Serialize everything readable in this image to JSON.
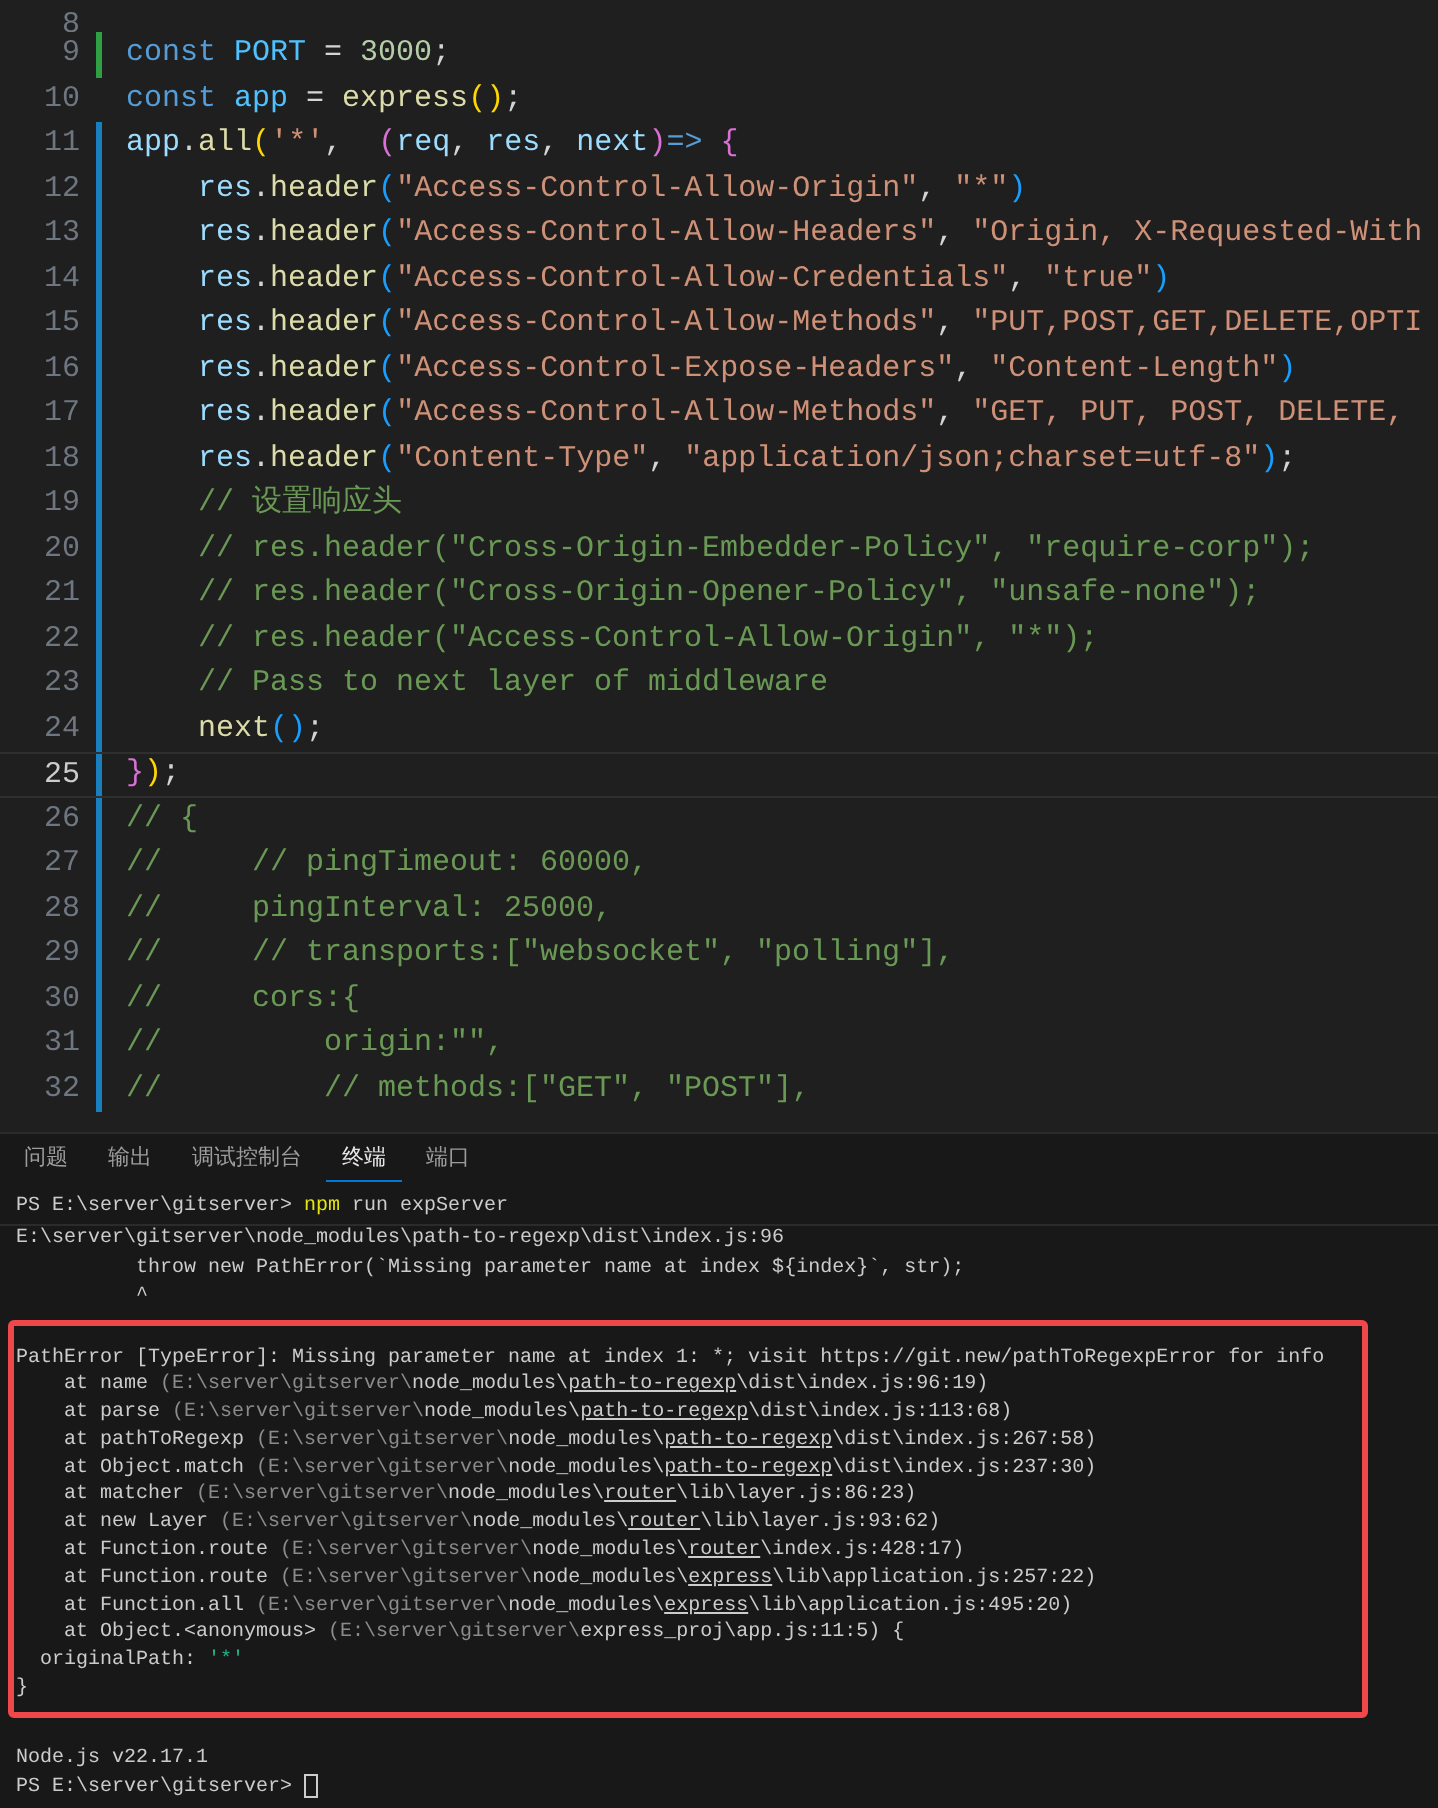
{
  "editor": {
    "lines": [
      {
        "number": "8",
        "added": false,
        "modified": false,
        "current": false
      },
      {
        "number": "9",
        "added": true,
        "modified": false,
        "current": false,
        "segments": [
          {
            "kind": "kw",
            "text": "const "
          },
          {
            "kind": "const",
            "text": "PORT"
          },
          {
            "kind": "txt",
            "text": " = "
          },
          {
            "kind": "num",
            "text": "3000"
          },
          {
            "kind": "txt",
            "text": ";"
          }
        ]
      },
      {
        "number": "10",
        "added": false,
        "modified": false,
        "current": false,
        "segments": [
          {
            "kind": "kw",
            "text": "const "
          },
          {
            "kind": "const",
            "text": "app"
          },
          {
            "kind": "txt",
            "text": " = "
          },
          {
            "kind": "fn",
            "text": "express"
          },
          {
            "kind": "b1",
            "text": "()"
          },
          {
            "kind": "txt",
            "text": ";"
          }
        ]
      },
      {
        "number": "11",
        "added": false,
        "modified": true,
        "current": false,
        "segments": [
          {
            "kind": "var",
            "text": "app"
          },
          {
            "kind": "txt",
            "text": "."
          },
          {
            "kind": "fn",
            "text": "all"
          },
          {
            "kind": "b1",
            "text": "("
          },
          {
            "kind": "str",
            "text": "'*'"
          },
          {
            "kind": "txt",
            "text": ",  "
          },
          {
            "kind": "b2",
            "text": "("
          },
          {
            "kind": "var",
            "text": "req"
          },
          {
            "kind": "txt",
            "text": ", "
          },
          {
            "kind": "var",
            "text": "res"
          },
          {
            "kind": "txt",
            "text": ", "
          },
          {
            "kind": "var",
            "text": "next"
          },
          {
            "kind": "b2",
            "text": ")"
          },
          {
            "kind": "kw",
            "text": "=>"
          },
          {
            "kind": "b2",
            "text": " {"
          }
        ]
      },
      {
        "number": "12",
        "added": false,
        "modified": true,
        "current": false,
        "segments": [
          {
            "kind": "var",
            "text": "    res"
          },
          {
            "kind": "txt",
            "text": "."
          },
          {
            "kind": "fn",
            "text": "header"
          },
          {
            "kind": "b3",
            "text": "("
          },
          {
            "kind": "str",
            "text": "\"Access-Control-Allow-Origin\""
          },
          {
            "kind": "txt",
            "text": ", "
          },
          {
            "kind": "str",
            "text": "\"*\""
          },
          {
            "kind": "b3",
            "text": ")"
          }
        ]
      },
      {
        "number": "13",
        "added": false,
        "modified": true,
        "current": false,
        "segments": [
          {
            "kind": "var",
            "text": "    res"
          },
          {
            "kind": "txt",
            "text": "."
          },
          {
            "kind": "fn",
            "text": "header"
          },
          {
            "kind": "b3",
            "text": "("
          },
          {
            "kind": "str",
            "text": "\"Access-Control-Allow-Headers\""
          },
          {
            "kind": "txt",
            "text": ", "
          },
          {
            "kind": "str",
            "text": "\"Origin, X-Requested-With"
          }
        ]
      },
      {
        "number": "14",
        "added": false,
        "modified": true,
        "current": false,
        "segments": [
          {
            "kind": "var",
            "text": "    res"
          },
          {
            "kind": "txt",
            "text": "."
          },
          {
            "kind": "fn",
            "text": "header"
          },
          {
            "kind": "b3",
            "text": "("
          },
          {
            "kind": "str",
            "text": "\"Access-Control-Allow-Credentials\""
          },
          {
            "kind": "txt",
            "text": ", "
          },
          {
            "kind": "str",
            "text": "\"true\""
          },
          {
            "kind": "b3",
            "text": ")"
          }
        ]
      },
      {
        "number": "15",
        "added": false,
        "modified": true,
        "current": false,
        "segments": [
          {
            "kind": "var",
            "text": "    res"
          },
          {
            "kind": "txt",
            "text": "."
          },
          {
            "kind": "fn",
            "text": "header"
          },
          {
            "kind": "b3",
            "text": "("
          },
          {
            "kind": "str",
            "text": "\"Access-Control-Allow-Methods\""
          },
          {
            "kind": "txt",
            "text": ", "
          },
          {
            "kind": "str",
            "text": "\"PUT,POST,GET,DELETE,OPTI"
          }
        ]
      },
      {
        "number": "16",
        "added": false,
        "modified": true,
        "current": false,
        "segments": [
          {
            "kind": "var",
            "text": "    res"
          },
          {
            "kind": "txt",
            "text": "."
          },
          {
            "kind": "fn",
            "text": "header"
          },
          {
            "kind": "b3",
            "text": "("
          },
          {
            "kind": "str",
            "text": "\"Access-Control-Expose-Headers\""
          },
          {
            "kind": "txt",
            "text": ", "
          },
          {
            "kind": "str",
            "text": "\"Content-Length\""
          },
          {
            "kind": "b3",
            "text": ")"
          }
        ]
      },
      {
        "number": "17",
        "added": false,
        "modified": true,
        "current": false,
        "segments": [
          {
            "kind": "var",
            "text": "    res"
          },
          {
            "kind": "txt",
            "text": "."
          },
          {
            "kind": "fn",
            "text": "header"
          },
          {
            "kind": "b3",
            "text": "("
          },
          {
            "kind": "str",
            "text": "\"Access-Control-Allow-Methods\""
          },
          {
            "kind": "txt",
            "text": ", "
          },
          {
            "kind": "str",
            "text": "\"GET, PUT, POST, DELETE,"
          }
        ]
      },
      {
        "number": "18",
        "added": false,
        "modified": true,
        "current": false,
        "segments": [
          {
            "kind": "var",
            "text": "    res"
          },
          {
            "kind": "txt",
            "text": "."
          },
          {
            "kind": "fn",
            "text": "header"
          },
          {
            "kind": "b3",
            "text": "("
          },
          {
            "kind": "str",
            "text": "\"Content-Type\""
          },
          {
            "kind": "txt",
            "text": ", "
          },
          {
            "kind": "str",
            "text": "\"application/json;charset=utf-8\""
          },
          {
            "kind": "b3",
            "text": ")"
          },
          {
            "kind": "txt",
            "text": ";"
          }
        ]
      },
      {
        "number": "19",
        "added": false,
        "modified": true,
        "current": false,
        "segments": [
          {
            "kind": "cmt",
            "text": "    // 设置响应头"
          }
        ]
      },
      {
        "number": "20",
        "added": false,
        "modified": true,
        "current": false,
        "segments": [
          {
            "kind": "cmt",
            "text": "    // res.header(\"Cross-Origin-Embedder-Policy\", \"require-corp\");"
          }
        ]
      },
      {
        "number": "21",
        "added": false,
        "modified": true,
        "current": false,
        "segments": [
          {
            "kind": "cmt",
            "text": "    // res.header(\"Cross-Origin-Opener-Policy\", \"unsafe-none\");"
          }
        ]
      },
      {
        "number": "22",
        "added": false,
        "modified": true,
        "current": false,
        "segments": [
          {
            "kind": "cmt",
            "text": "    // res.header(\"Access-Control-Allow-Origin\", \"*\");"
          }
        ]
      },
      {
        "number": "23",
        "added": false,
        "modified": true,
        "current": false,
        "segments": [
          {
            "kind": "cmt",
            "text": "    // Pass to next layer of middleware"
          }
        ]
      },
      {
        "number": "24",
        "added": false,
        "modified": true,
        "current": false,
        "segments": [
          {
            "kind": "fn",
            "text": "    next"
          },
          {
            "kind": "b3",
            "text": "()"
          },
          {
            "kind": "txt",
            "text": ";"
          }
        ]
      },
      {
        "number": "25",
        "added": false,
        "modified": true,
        "current": true,
        "segments": [
          {
            "kind": "b2",
            "text": "}"
          },
          {
            "kind": "b1",
            "text": ")"
          },
          {
            "kind": "txt",
            "text": ";"
          }
        ]
      },
      {
        "number": "26",
        "added": false,
        "modified": true,
        "current": false,
        "segments": [
          {
            "kind": "cmt",
            "text": "// {"
          }
        ]
      },
      {
        "number": "27",
        "added": false,
        "modified": true,
        "current": false,
        "segments": [
          {
            "kind": "cmt",
            "text": "//     // pingTimeout: 60000,"
          }
        ]
      },
      {
        "number": "28",
        "added": false,
        "modified": true,
        "current": false,
        "segments": [
          {
            "kind": "cmt",
            "text": "//     pingInterval: 25000,"
          }
        ]
      },
      {
        "number": "29",
        "added": false,
        "modified": true,
        "current": false,
        "segments": [
          {
            "kind": "cmt",
            "text": "//     // transports:[\"websocket\", \"polling\"],"
          }
        ]
      },
      {
        "number": "30",
        "added": false,
        "modified": true,
        "current": false,
        "segments": [
          {
            "kind": "cmt",
            "text": "//     cors:{"
          }
        ]
      },
      {
        "number": "31",
        "added": false,
        "modified": true,
        "current": false,
        "segments": [
          {
            "kind": "cmt",
            "text": "//         origin:\"\","
          }
        ]
      },
      {
        "number": "32",
        "added": false,
        "modified": true,
        "current": false,
        "segments": [
          {
            "kind": "cmt",
            "text": "//         // methods:[\"GET\", \"POST\"],"
          }
        ]
      }
    ]
  },
  "panel": {
    "tabs": [
      {
        "label": "问题",
        "selected": false
      },
      {
        "label": "输出",
        "selected": false
      },
      {
        "label": "调试控制台",
        "selected": false
      },
      {
        "label": "终端",
        "selected": true
      },
      {
        "label": "端口",
        "selected": false
      }
    ]
  },
  "terminal": {
    "lines": [
      {
        "rule_below": true,
        "segments": [
          {
            "kind": "txt",
            "text": "PS E:\\server\\gitserver> "
          },
          {
            "kind": "cmd",
            "text": "npm"
          },
          {
            "kind": "txt",
            "text": " run expServer"
          }
        ]
      },
      {
        "rule_below": false,
        "segments": [
          {
            "kind": "txt",
            "text": "E:\\server\\gitserver\\node_modules\\path-to-regexp\\dist\\index.js:96"
          }
        ]
      },
      {
        "rule_below": false,
        "segments": [
          {
            "kind": "txt",
            "text": "          throw new PathError(`Missing parameter name at index ${index}`, str);"
          }
        ]
      },
      {
        "rule_below": false,
        "segments": [
          {
            "kind": "txt",
            "text": "          ^"
          }
        ]
      }
    ],
    "error_box": {
      "lines": [
        {
          "segments": [
            {
              "kind": "txt",
              "text": "PathError [TypeError]: Missing parameter name at index 1: *; visit https://git.new/pathToRegexpError for info"
            }
          ]
        },
        {
          "segments": [
            {
              "kind": "txt",
              "text": "    at name "
            },
            {
              "kind": "dim",
              "text": "(E:\\server\\gitserver\\"
            },
            {
              "kind": "txt",
              "text": "node_modules\\"
            },
            {
              "kind": "link",
              "text": "path-to-regexp"
            },
            {
              "kind": "txt",
              "text": "\\dist\\index.js:96:19)"
            }
          ]
        },
        {
          "segments": [
            {
              "kind": "txt",
              "text": "    at parse "
            },
            {
              "kind": "dim",
              "text": "(E:\\server\\gitserver\\"
            },
            {
              "kind": "txt",
              "text": "node_modules\\"
            },
            {
              "kind": "link",
              "text": "path-to-regexp"
            },
            {
              "kind": "txt",
              "text": "\\dist\\index.js:113:68)"
            }
          ]
        },
        {
          "segments": [
            {
              "kind": "txt",
              "text": "    at pathToRegexp "
            },
            {
              "kind": "dim",
              "text": "(E:\\server\\gitserver\\"
            },
            {
              "kind": "txt",
              "text": "node_modules\\"
            },
            {
              "kind": "link",
              "text": "path-to-regexp"
            },
            {
              "kind": "txt",
              "text": "\\dist\\index.js:267:58)"
            }
          ]
        },
        {
          "segments": [
            {
              "kind": "txt",
              "text": "    at Object.match "
            },
            {
              "kind": "dim",
              "text": "(E:\\server\\gitserver\\"
            },
            {
              "kind": "txt",
              "text": "node_modules\\"
            },
            {
              "kind": "link",
              "text": "path-to-regexp"
            },
            {
              "kind": "txt",
              "text": "\\dist\\index.js:237:30)"
            }
          ]
        },
        {
          "segments": [
            {
              "kind": "txt",
              "text": "    at matcher "
            },
            {
              "kind": "dim",
              "text": "(E:\\server\\gitserver\\"
            },
            {
              "kind": "txt",
              "text": "node_modules\\"
            },
            {
              "kind": "link",
              "text": "router"
            },
            {
              "kind": "txt",
              "text": "\\lib\\layer.js:86:23)"
            }
          ]
        },
        {
          "segments": [
            {
              "kind": "txt",
              "text": "    at new Layer "
            },
            {
              "kind": "dim",
              "text": "(E:\\server\\gitserver\\"
            },
            {
              "kind": "txt",
              "text": "node_modules\\"
            },
            {
              "kind": "link",
              "text": "router"
            },
            {
              "kind": "txt",
              "text": "\\lib\\layer.js:93:62)"
            }
          ]
        },
        {
          "segments": [
            {
              "kind": "txt",
              "text": "    at Function.route "
            },
            {
              "kind": "dim",
              "text": "(E:\\server\\gitserver\\"
            },
            {
              "kind": "txt",
              "text": "node_modules\\"
            },
            {
              "kind": "link",
              "text": "router"
            },
            {
              "kind": "txt",
              "text": "\\index.js:428:17)"
            }
          ]
        },
        {
          "segments": [
            {
              "kind": "txt",
              "text": "    at Function.route "
            },
            {
              "kind": "dim",
              "text": "(E:\\server\\gitserver\\"
            },
            {
              "kind": "txt",
              "text": "node_modules\\"
            },
            {
              "kind": "link",
              "text": "express"
            },
            {
              "kind": "txt",
              "text": "\\lib\\application.js:257:22)"
            }
          ]
        },
        {
          "segments": [
            {
              "kind": "txt",
              "text": "    at Function.all "
            },
            {
              "kind": "dim",
              "text": "(E:\\server\\gitserver\\"
            },
            {
              "kind": "txt",
              "text": "node_modules\\"
            },
            {
              "kind": "link",
              "text": "express"
            },
            {
              "kind": "txt",
              "text": "\\lib\\application.js:495:20)"
            }
          ]
        },
        {
          "segments": [
            {
              "kind": "txt",
              "text": "    at Object.<anonymous> "
            },
            {
              "kind": "dim",
              "text": "(E:\\server\\gitserver\\"
            },
            {
              "kind": "txt",
              "text": "express_proj\\app.js:11:5) {"
            }
          ]
        },
        {
          "segments": [
            {
              "kind": "txt",
              "text": "  originalPath: "
            },
            {
              "kind": "str",
              "text": "'*'"
            }
          ]
        },
        {
          "segments": [
            {
              "kind": "txt",
              "text": "}"
            }
          ]
        }
      ]
    },
    "after_lines": [
      {
        "cursor": false,
        "segments": [
          {
            "kind": "txt",
            "text": "Node.js v22.17.1"
          }
        ]
      },
      {
        "cursor": true,
        "segments": [
          {
            "kind": "txt",
            "text": "PS E:\\server\\gitserver> "
          }
        ]
      }
    ]
  }
}
